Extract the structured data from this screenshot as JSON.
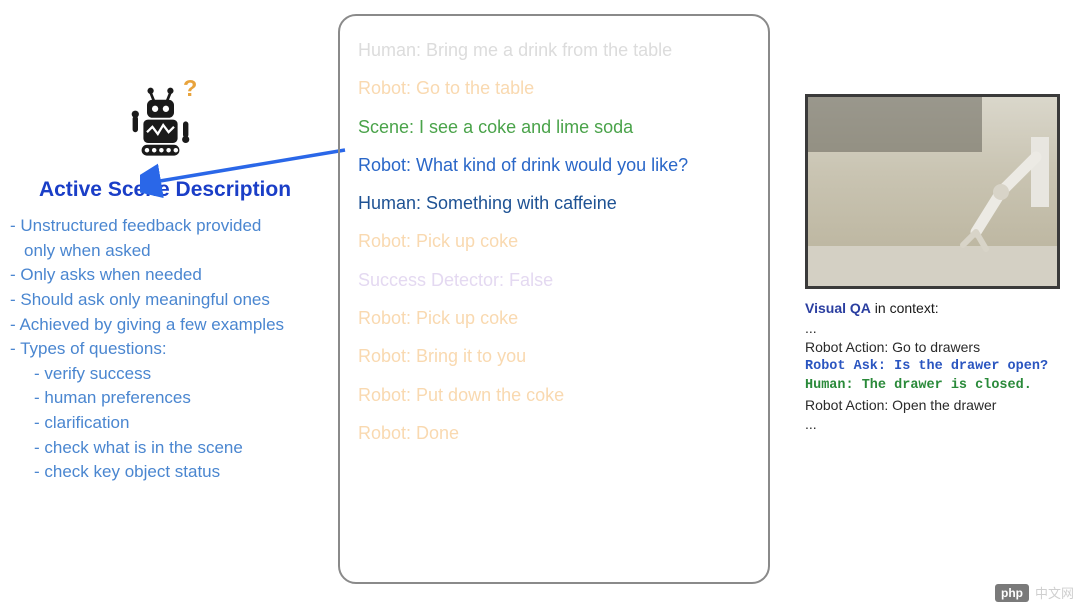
{
  "left": {
    "title": "Active Scene Description",
    "bullets": [
      "- Unstructured feedback provided",
      "only when asked",
      "- Only asks when needed",
      "- Should ask only meaningful ones",
      "- Achieved by giving a few examples",
      "- Types of questions:"
    ],
    "sub_bullets": [
      "- verify success",
      "- human preferences",
      "- clarification",
      "- check what is in the scene",
      "- check key object status"
    ]
  },
  "center": {
    "lines": [
      {
        "text": "Human: Bring me a drink from the table",
        "cls": "faded-grey"
      },
      {
        "text": "Robot: Go to the table",
        "cls": "faded-orange"
      },
      {
        "text": "Scene: I see a coke and lime soda",
        "cls": "green"
      },
      {
        "text": "Robot: What kind of drink would you like?",
        "cls": "blue-robot"
      },
      {
        "text": "Human: Something with caffeine",
        "cls": "blue-human"
      },
      {
        "text": "Robot: Pick up coke",
        "cls": "faded-orange"
      },
      {
        "text": "Success Detector: False",
        "cls": "faded-purple"
      },
      {
        "text": "Robot: Pick up coke",
        "cls": "faded-orange"
      },
      {
        "text": "Robot: Bring it to you",
        "cls": "faded-orange"
      },
      {
        "text": "Robot: Put down the coke",
        "cls": "faded-orange"
      },
      {
        "text": "Robot: Done",
        "cls": "faded-orange"
      }
    ]
  },
  "right": {
    "title_prefix": "Visual QA",
    "title_suffix": " in context:",
    "ellipsis": "...",
    "action1": "Robot Action: Go to drawers",
    "ask": "Robot Ask: Is the drawer open?",
    "human": "Human: The drawer is closed.",
    "action2": "Robot Action: Open the drawer"
  },
  "watermark": {
    "label": "php",
    "text": "中文网"
  }
}
